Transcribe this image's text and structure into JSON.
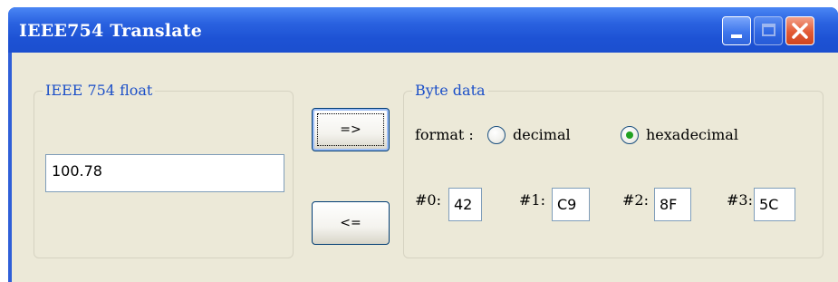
{
  "window": {
    "title": "IEEE754  Translate"
  },
  "float_group": {
    "legend": "IEEE 754 float",
    "value": "100.78"
  },
  "buttons": {
    "to_bytes": "=>",
    "to_float": "<="
  },
  "byte_group": {
    "legend": "Byte data",
    "format_label": "format :",
    "options": [
      {
        "label": "decimal",
        "selected": false
      },
      {
        "label": "hexadecimal",
        "selected": true
      }
    ],
    "bytes": [
      {
        "label": "#0:",
        "value": "42"
      },
      {
        "label": "#1:",
        "value": "C9"
      },
      {
        "label": "#2:",
        "value": "8F"
      },
      {
        "label": "#3:",
        "value": "5C"
      }
    ]
  },
  "colors": {
    "titlebar": "#2458d8",
    "client": "#ece9d8",
    "legend_text": "#1b4fc8",
    "radio_selected": "#21a121",
    "close_button": "#e25a34"
  }
}
